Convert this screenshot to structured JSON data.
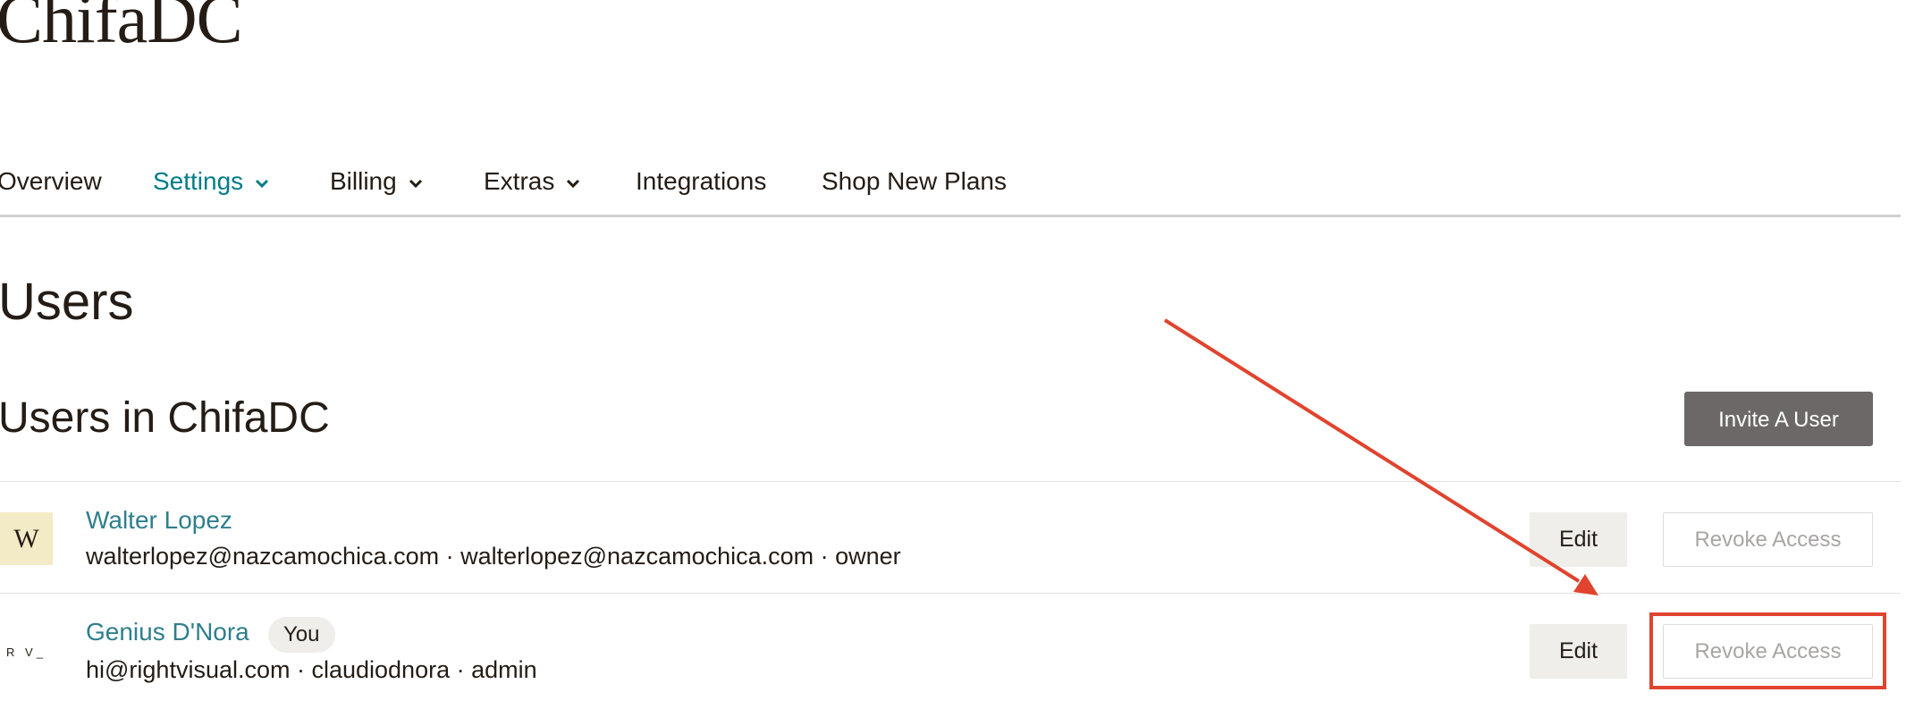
{
  "account": {
    "name": "ChifaDC"
  },
  "nav": {
    "items": [
      {
        "label": "Overview",
        "has_dropdown": false,
        "active": false
      },
      {
        "label": "Settings",
        "has_dropdown": true,
        "active": true
      },
      {
        "label": "Billing",
        "has_dropdown": true,
        "active": false
      },
      {
        "label": "Extras",
        "has_dropdown": true,
        "active": false
      },
      {
        "label": "Integrations",
        "has_dropdown": false,
        "active": false
      },
      {
        "label": "Shop New Plans",
        "has_dropdown": false,
        "active": false
      }
    ]
  },
  "page": {
    "title": "Users"
  },
  "section": {
    "title": "Users in ChifaDC",
    "invite_label": "Invite A User"
  },
  "users": [
    {
      "avatar_text": "W",
      "name": "Walter Lopez",
      "meta": "walterlopez@nazcamochica.com · walterlopez@nazcamochica.com · owner",
      "edit_label": "Edit",
      "revoke_label": "Revoke Access"
    },
    {
      "avatar_text": "R V_",
      "name": "Genius D'Nora",
      "badge": "You",
      "meta": "hi@rightvisual.com · claudiodnora · admin",
      "edit_label": "Edit",
      "revoke_label": "Revoke Access"
    }
  ],
  "colors": {
    "link": "#007c89",
    "name": "#2f7f8c",
    "primary_button": "#6d6868",
    "annotation": "#e0442e"
  },
  "icons": {
    "dropdown": "chevron-down-icon"
  }
}
